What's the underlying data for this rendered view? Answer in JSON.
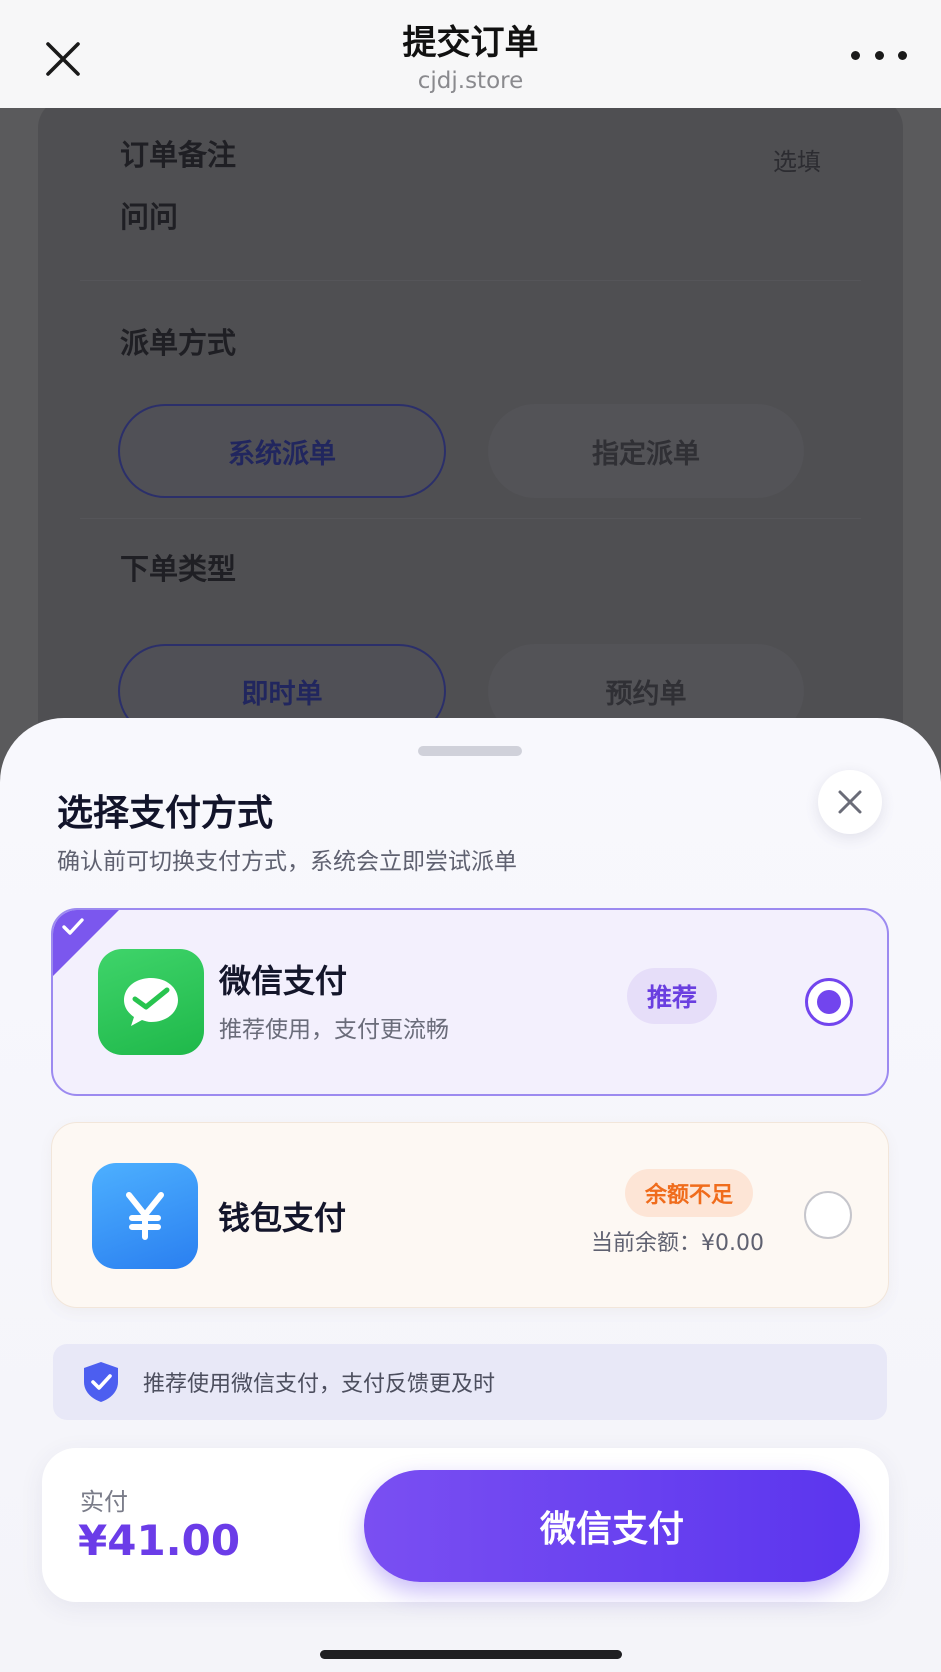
{
  "navbar": {
    "title": "提交订单",
    "subtitle": "cjdj.store",
    "close_icon": "close-icon",
    "more_icon": "more-icon"
  },
  "background_form": {
    "remark_label": "订单备注",
    "remark_optional": "选填",
    "remark_value": "问问",
    "dispatch_label": "派单方式",
    "dispatch_options": [
      "系统派单",
      "指定派单"
    ],
    "dispatch_selected": "系统派单",
    "order_type_label": "下单类型",
    "order_type_options": [
      "即时单",
      "预约单"
    ],
    "order_type_selected": "即时单"
  },
  "sheet": {
    "title": "选择支付方式",
    "subtitle": "确认前可切换支付方式，系统会立即尝试派单",
    "close_icon": "close-icon",
    "methods": [
      {
        "name": "微信支付",
        "desc": "推荐使用，支付更流畅",
        "badge": "推荐",
        "selected": true,
        "icon": "wechat-pay-icon",
        "color": "#28c44f"
      },
      {
        "name": "钱包支付",
        "badge": "余额不足",
        "balance": "当前余额：¥0.00",
        "selected": false,
        "icon": "wallet-yen-icon",
        "color": "#3592f6"
      }
    ],
    "tip": "推荐使用微信支付，支付反馈更及时",
    "tip_icon": "shield-check-icon"
  },
  "pay_bar": {
    "label": "实付",
    "amount": "¥41.00",
    "button": "微信支付"
  },
  "colors": {
    "accent": "#6b3ce8",
    "warning": "#f06c1c"
  }
}
